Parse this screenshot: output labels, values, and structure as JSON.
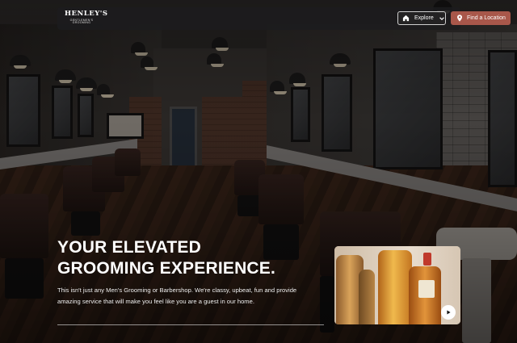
{
  "brand": {
    "logo_text": "HENLEY'S",
    "logo_tagline": "GENTLEMEN'S GROOMING"
  },
  "header": {
    "explore_label": "Explore",
    "explore_icon": "home-icon",
    "explore_caret": "chevron-down-icon",
    "find_location_label": "Find a Location",
    "find_location_icon": "map-pin-icon",
    "find_location_color": "#A8574A"
  },
  "hero": {
    "title": "YOUR ELEVATED GROOMING EXPERIENCE.",
    "body": "This isn't just any Men's Grooming or Barbershop. We're classy, upbeat, fun and provide amazing service that will make you feel like you are a guest in our home."
  },
  "video": {
    "play_icon": "play-icon"
  }
}
